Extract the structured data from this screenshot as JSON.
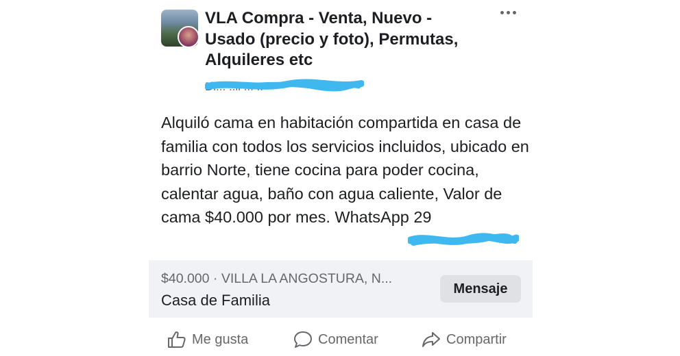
{
  "post": {
    "group_name": "VLA Compra - Venta, Nuevo - Usado (precio y foto), Permutas, Alquileres etc",
    "author_partial": "Di... ..ll ... ..",
    "body": "Alquiló cama en habitación compartida en casa de familia con todos los servicios incluidos, ubicado en barrio Norte, tiene cocina para poder cocina, calentar agua, baño con agua caliente, Valor de cama $40.000 por mes. WhatsApp 29",
    "redaction_color": "#3fb8f0"
  },
  "listing": {
    "meta": "$40.000 · VILLA LA ANGOSTURA, N...",
    "title": "Casa de Familia",
    "message_button": "Mensaje"
  },
  "actions": {
    "like": "Me gusta",
    "comment": "Comentar",
    "share": "Compartir"
  },
  "icons": [
    "more-options-icon",
    "like-icon",
    "comment-icon",
    "share-icon"
  ]
}
